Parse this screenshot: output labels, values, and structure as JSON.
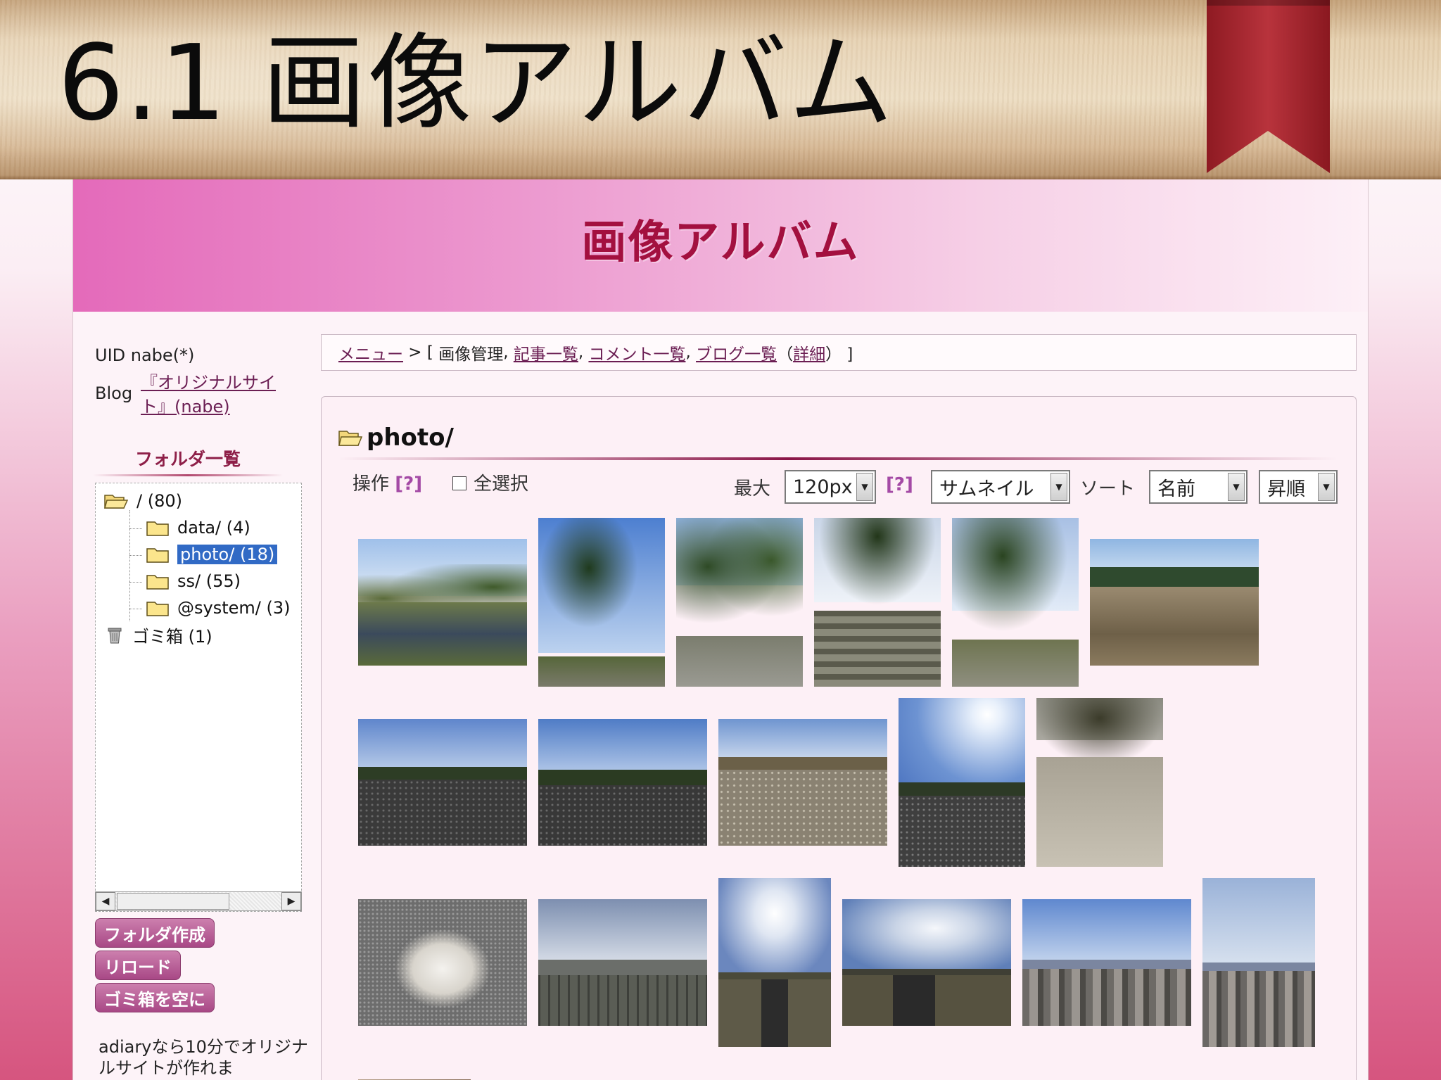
{
  "slide": {
    "title": "6.1 画像アルバム"
  },
  "app": {
    "banner_title": "画像アルバム",
    "sidebar": {
      "uid_label": "UID nabe(*)",
      "blog_label": "Blog",
      "blog_link_line1": "『オリジナルサイ",
      "blog_link_line2": "ト』(nabe)",
      "folders_heading": "フォルダ一覧",
      "tree": [
        {
          "label": "/ (80)",
          "icon": "folder-open-icon"
        },
        {
          "label": "data/ (4)",
          "icon": "folder-icon"
        },
        {
          "label": "photo/ (18)",
          "icon": "folder-icon",
          "selected": true
        },
        {
          "label": "ss/ (55)",
          "icon": "folder-icon"
        },
        {
          "label": "@system/ (3)",
          "icon": "folder-icon"
        },
        {
          "label": "ゴミ箱 (1)",
          "icon": "trash-icon"
        }
      ],
      "buttons": {
        "create_folder": "フォルダ作成",
        "reload": "リロード",
        "empty_trash": "ゴミ箱を空に"
      },
      "promo_text": "adiaryなら10分でオリジナルサイトが作れま"
    },
    "breadcrumb": {
      "menu": "メニュー",
      "sep": " > [ ",
      "current": "画像管理",
      "comma1": ", ",
      "articles": "記事一覧",
      "comma2": ", ",
      "comments": "コメント一覧",
      "comma3": ", ",
      "blogs": "ブログ一覧",
      "paren_open": "（",
      "detail": "詳細",
      "paren_close": "） ]"
    },
    "panel": {
      "folder_title": "photo/",
      "operation_label": "操作",
      "help_label": "[?]",
      "select_all_label": "全選択",
      "max_label": "最大",
      "max_value": "120px",
      "view_mode": "サムネイル",
      "sort_label": "ソート",
      "sort_key": "名前",
      "sort_order": "昇順"
    },
    "colors": {
      "banner_title": "#a3103f",
      "selected_item": "#316ac5",
      "button": "#b05a92"
    }
  }
}
